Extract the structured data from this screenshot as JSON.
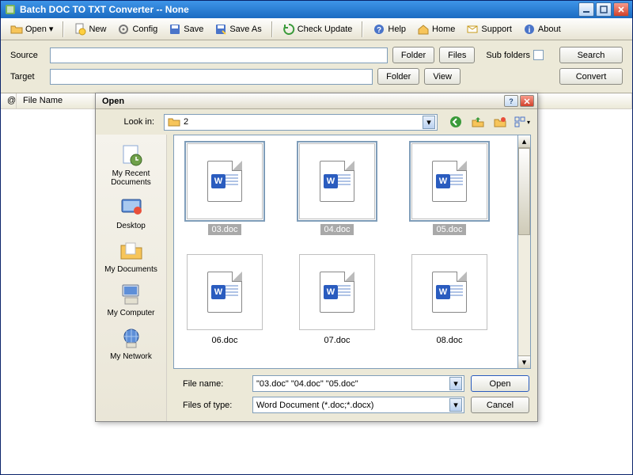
{
  "titlebar": {
    "title": "Batch DOC TO TXT Converter -- None"
  },
  "toolbar": {
    "open": "Open",
    "new": "New",
    "config": "Config",
    "save": "Save",
    "saveas": "Save As",
    "check": "Check Update",
    "help": "Help",
    "home": "Home",
    "support": "Support",
    "about": "About"
  },
  "panel": {
    "source_label": "Source",
    "target_label": "Target",
    "folder_btn": "Folder",
    "files_btn": "Files",
    "view_btn": "View",
    "subfolders_label": "Sub folders",
    "search_btn": "Search",
    "convert_btn": "Convert",
    "source_value": "",
    "target_value": ""
  },
  "list": {
    "col_at": "@",
    "col_filename": "File Name"
  },
  "dialog": {
    "title": "Open",
    "lookin_label": "Look in:",
    "lookin_value": "2",
    "places": [
      "My Recent Documents",
      "Desktop",
      "My Documents",
      "My Computer",
      "My Network"
    ],
    "files": [
      {
        "name": "03.doc",
        "selected": true
      },
      {
        "name": "04.doc",
        "selected": true
      },
      {
        "name": "05.doc",
        "selected": true
      },
      {
        "name": "06.doc",
        "selected": false
      },
      {
        "name": "07.doc",
        "selected": false
      },
      {
        "name": "08.doc",
        "selected": false
      }
    ],
    "filename_label": "File name:",
    "filename_value": "\"03.doc\" \"04.doc\" \"05.doc\"",
    "filetype_label": "Files of type:",
    "filetype_value": "Word Document (*.doc;*.docx)",
    "open_btn": "Open",
    "cancel_btn": "Cancel"
  }
}
